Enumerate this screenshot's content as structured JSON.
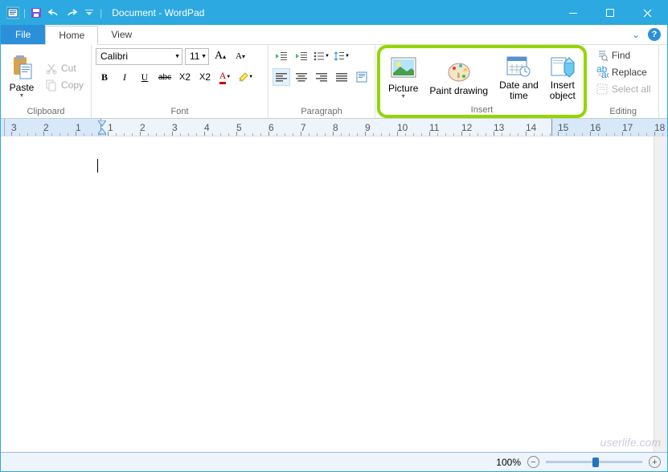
{
  "title": "Document - WordPad",
  "tabs": {
    "file": "File",
    "home": "Home",
    "view": "View"
  },
  "clipboard": {
    "paste": "Paste",
    "cut": "Cut",
    "copy": "Copy",
    "label": "Clipboard"
  },
  "font": {
    "name": "Calibri",
    "size": "11",
    "label": "Font",
    "bold": "B",
    "italic": "I",
    "underline": "U",
    "strike": "abc",
    "sub": "X₂",
    "sup": "X²"
  },
  "paragraph": {
    "label": "Paragraph"
  },
  "insert": {
    "picture": "Picture",
    "paint": "Paint drawing",
    "datetime_l1": "Date and",
    "datetime_l2": "time",
    "object_l1": "Insert",
    "object_l2": "object",
    "label": "Insert"
  },
  "editing": {
    "find": "Find",
    "replace": "Replace",
    "selectall": "Select all",
    "label": "Editing"
  },
  "status": {
    "zoom": "100%"
  },
  "watermark": "userlife.com"
}
